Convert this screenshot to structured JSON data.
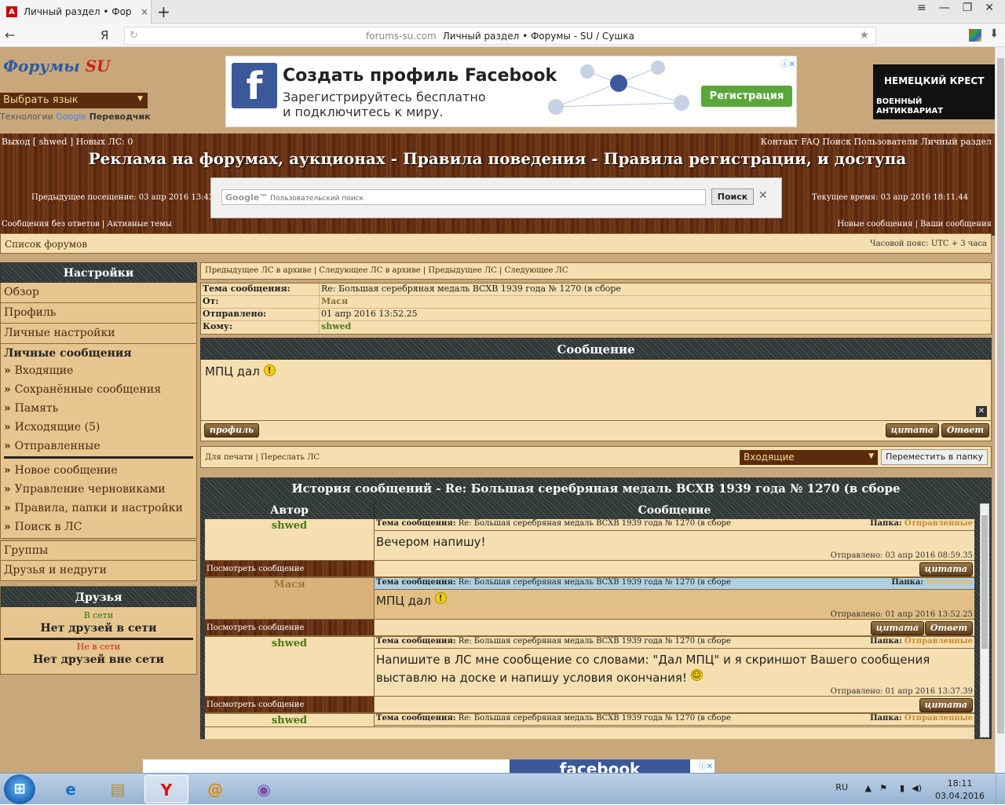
{
  "browser": {
    "tab_title": "Личный раздел • Форумы",
    "tab_close": "×",
    "new_tab": "+",
    "back": "←",
    "yandex": "Я",
    "url_domain": "forums-su.com",
    "url_title": "Личный раздел • Форумы - SU / Сушка",
    "window_buttons": [
      "≡",
      "—",
      "❐",
      "✕"
    ]
  },
  "header": {
    "logo_text": "Форумы",
    "logo_su": "SU",
    "language_select": "Выбрать язык",
    "translate_prefix": "Технологии",
    "translate_google": "Google",
    "translate_label": "Переводчик",
    "fb_ad": {
      "title": "Создать профиль Facebook",
      "line1": "Зарегистрируйтесь бесплатно",
      "line2": "и подключитесь к миру.",
      "button": "Регистрация",
      "adchoices": "ⓘ✕"
    },
    "side_ad": {
      "line1": "НЕМЕЦКИЙ КРЕСТ",
      "line2": "ВОЕННЫЙ",
      "line3": "АНТИКВАРИАТ"
    }
  },
  "topbar": {
    "left": "Выход [ shwed ]   Новых ЛС: 0",
    "right": "Контакт   FAQ   Поиск   Пользователи   Личный раздел",
    "title": "Реклама на форумах, аукционах - Правила поведения - Правила регистрации, и доступа",
    "prev_visit": "Предыдущее посещение: 03 апр 2016 13:42.54",
    "current_time": "Текущее время: 03 апр 2016 18:11.44",
    "search_brand": "Google™",
    "search_placeholder": "Пользовательский поиск",
    "search_button": "Поиск",
    "search_clear": "✕",
    "nav_left": "Сообщения без ответов  |  Активные темы",
    "nav_right": "Новые сообщения  |  Ваши сообщения"
  },
  "breadcrumb": {
    "forum_list": "Список форумов",
    "timezone": "Часовой пояс: UTC + 3 часа"
  },
  "sidebar": {
    "settings_title": "Настройки",
    "items": [
      "Обзор",
      "Профиль",
      "Личные настройки"
    ],
    "pm_title": "Личные сообщения",
    "pm_items": [
      "Входящие",
      "Сохранённые сообщения",
      "Память",
      "Исходящие (5)",
      "Отправленные"
    ],
    "pm_items2": [
      "Новое сообщение",
      "Управление черновиками",
      "Правила, папки и настройки",
      "Поиск в ЛС"
    ],
    "groups": "Группы",
    "friends_foes": "Друзья и недруги",
    "friends_title": "Друзья",
    "online": "В сети",
    "no_online": "Нет друзей в сети",
    "offline": "Не в сети",
    "no_offline": "Нет друзей вне сети"
  },
  "pm": {
    "nav": "Предыдущее ЛС в архиве  |  Следующее ЛС в архиве  |  Предыдущее ЛС  |  Следующее ЛС",
    "subject_label": "Тема сообщения:",
    "subject": "Re: Большая серебряная медаль ВСХВ 1939 года № 1270 (в сборе",
    "from_label": "От:",
    "from": "Мася",
    "sent_label": "Отправлено:",
    "sent": "01 апр 2016 13:52.25",
    "to_label": "Кому:",
    "to": "shwed",
    "message_title": "Сообщение",
    "body": "МПЦ дал",
    "profile_btn": "профиль",
    "quote_btn": "цитата",
    "reply_btn": "Ответ",
    "print": "Для печати  |  Переслать ЛС",
    "folder": "Входящие",
    "move": "Переместить в папку"
  },
  "history": {
    "title": "История сообщений - Re: Большая серебряная медаль ВСХВ 1939 года № 1270 (в сборе",
    "col_author": "Автор",
    "col_message": "Сообщение",
    "subj_label": "Тема сообщения:",
    "subj": "Re: Большая серебряная медаль ВСХВ 1939 года № 1270 (в сборе",
    "folder_label": "Папка:",
    "view": "Посмотреть сообщение",
    "quote": "цитата",
    "reply": "Ответ",
    "rows": [
      {
        "author": "shwed",
        "folder": "Отправленные",
        "text": "Вечером напишу!",
        "sent": "Отправлено: 03 апр 2016 08:59.35"
      },
      {
        "author": "Мася",
        "folder": "Входящие",
        "text": "МПЦ дал",
        "sent": "Отправлено: 01 апр 2016 13:52.25"
      },
      {
        "author": "shwed",
        "folder": "Отправленные",
        "text": "Напишите в ЛС мне сообщение со словами: \"Дал МПЦ\" и я скриншот Вашего сообщения выставлю на доске и напишу условия окончания!",
        "sent": "Отправлено: 01 апр 2016 13:37.39"
      },
      {
        "author": "shwed",
        "folder": "Отправленные"
      }
    ]
  },
  "bottom_ad": {
    "fb": "facebook",
    "adchoices": "ⓘ✕"
  },
  "taskbar": {
    "lang": "RU",
    "time": "18:11",
    "date": "03.04.2016",
    "apps": [
      "e",
      "▤",
      "Y",
      "@",
      "◉"
    ]
  }
}
